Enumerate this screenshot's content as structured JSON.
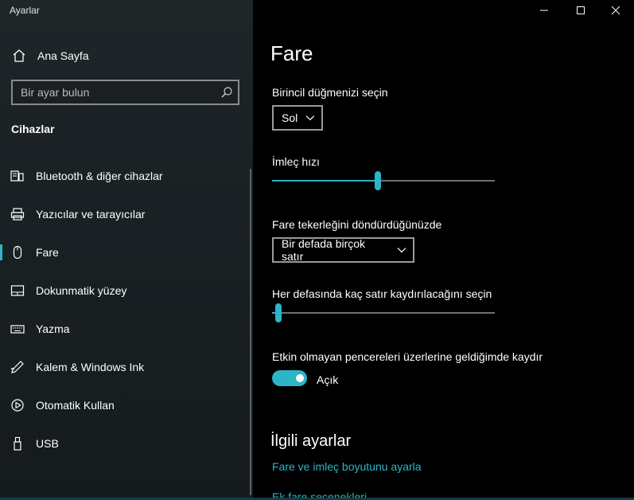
{
  "app": {
    "title": "Ayarlar"
  },
  "sidebar": {
    "home_label": "Ana Sayfa",
    "search_placeholder": "Bir ayar bulun",
    "section_title": "Cihazlar",
    "items": [
      {
        "label": "Bluetooth & diğer cihazlar",
        "icon": "bluetooth-devices-icon",
        "selected": false
      },
      {
        "label": "Yazıcılar ve tarayıcılar",
        "icon": "printer-icon",
        "selected": false
      },
      {
        "label": "Fare",
        "icon": "mouse-icon",
        "selected": true
      },
      {
        "label": "Dokunmatik yüzey",
        "icon": "touchpad-icon",
        "selected": false
      },
      {
        "label": "Yazma",
        "icon": "keyboard-icon",
        "selected": false
      },
      {
        "label": "Kalem & Windows Ink",
        "icon": "pen-icon",
        "selected": false
      },
      {
        "label": "Otomatik Kullan",
        "icon": "autoplay-icon",
        "selected": false
      },
      {
        "label": "USB",
        "icon": "usb-icon",
        "selected": false
      }
    ]
  },
  "main": {
    "title": "Fare",
    "primary_button": {
      "label": "Birincil düğmenizi seçin",
      "value": "Sol"
    },
    "cursor_speed": {
      "label": "İmleç hızı",
      "value_fraction": 0.475
    },
    "scroll_wheel": {
      "label": "Fare tekerleğini döndürdüğünüzde",
      "value": "Bir defada birçok satır"
    },
    "lines_to_scroll": {
      "label": "Her defasında kaç satır kaydırılacağını seçin",
      "value_fraction": 0.03
    },
    "inactive_scroll": {
      "label": "Etkin olmayan pencereleri üzerlerine geldiğimde kaydır",
      "state": "Açık",
      "on": true
    },
    "related": {
      "title": "İlgili ayarlar",
      "links": [
        "Fare ve imleç boyutunu ayarla",
        "Ek fare seçenekleri"
      ]
    }
  },
  "colors": {
    "accent": "#2bb5c7",
    "sidebar_bg": "#1c2326",
    "main_bg": "#000000"
  },
  "window_controls": [
    "minimize-icon",
    "maximize-icon",
    "close-icon"
  ]
}
